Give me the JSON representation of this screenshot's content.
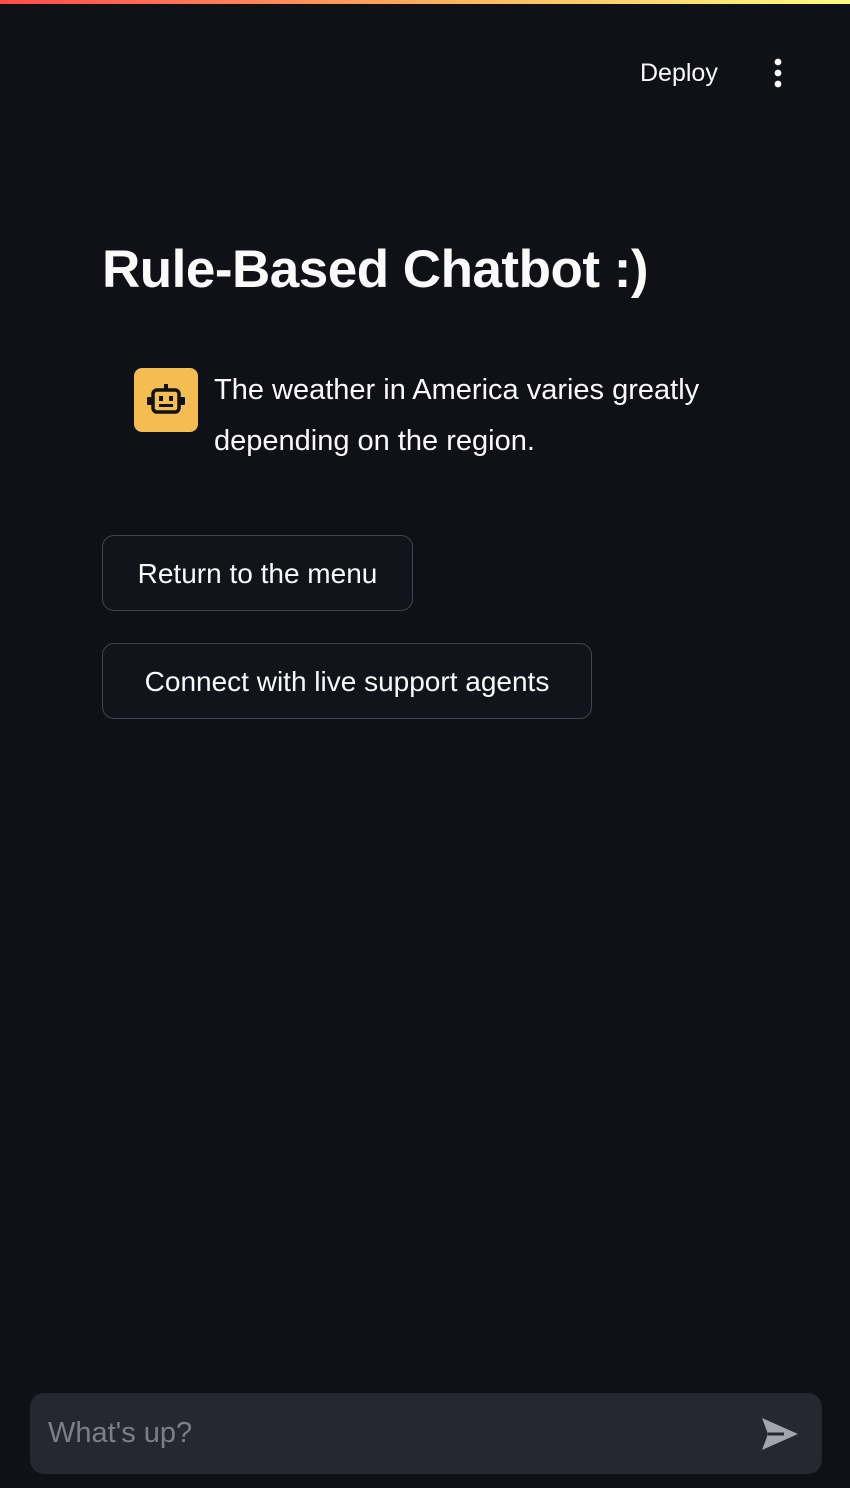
{
  "header": {
    "deploy_label": "Deploy",
    "menu_icon": "vertical-ellipsis-icon"
  },
  "decoration": {
    "gradient_colors": [
      "#ff4b4b",
      "#fdb760",
      "#fffd80"
    ]
  },
  "page": {
    "title": "Rule-Based Chatbot :)"
  },
  "chat": {
    "messages": [
      {
        "role": "assistant",
        "avatar_icon": "robot-icon",
        "avatar_color": "#f5bc52",
        "text": "The weather in America varies greatly depending on the region."
      }
    ],
    "buttons": [
      {
        "label": "Return to the menu"
      },
      {
        "label": "Connect with live support agents"
      }
    ],
    "input": {
      "placeholder": "What's up?",
      "value": "",
      "send_icon": "send-icon"
    }
  },
  "colors": {
    "background": "#0f1117",
    "text": "#fafafa",
    "input_background": "#262730",
    "button_border": "#42454f"
  }
}
